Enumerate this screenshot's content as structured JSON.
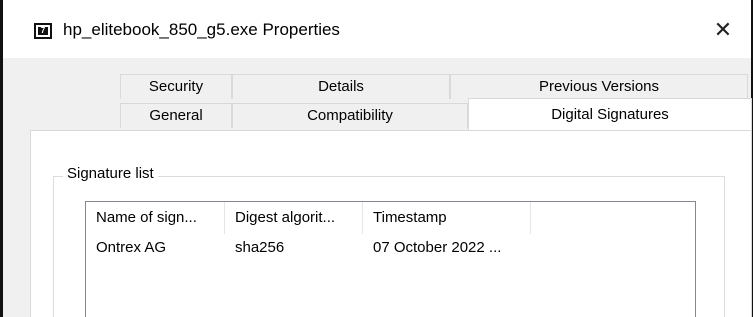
{
  "window": {
    "title": "hp_elitebook_850_g5.exe Properties",
    "close_glyph": "✕"
  },
  "tabs": {
    "row_back": [
      {
        "label": "Security"
      },
      {
        "label": "Details"
      },
      {
        "label": "Previous Versions"
      }
    ],
    "row_front": [
      {
        "label": "General"
      },
      {
        "label": "Compatibility"
      },
      {
        "label": "Digital Signatures",
        "selected": true
      }
    ]
  },
  "signature_list": {
    "group_label": "Signature list",
    "columns": [
      {
        "label": "Name of sign..."
      },
      {
        "label": "Digest algorit..."
      },
      {
        "label": "Timestamp"
      }
    ],
    "rows": [
      {
        "name": "Ontrex AG",
        "digest": "sha256",
        "timestamp": "07 October 2022 ..."
      }
    ]
  },
  "icons": {
    "app_icon": "7z-archive-icon",
    "close": "close-icon"
  }
}
